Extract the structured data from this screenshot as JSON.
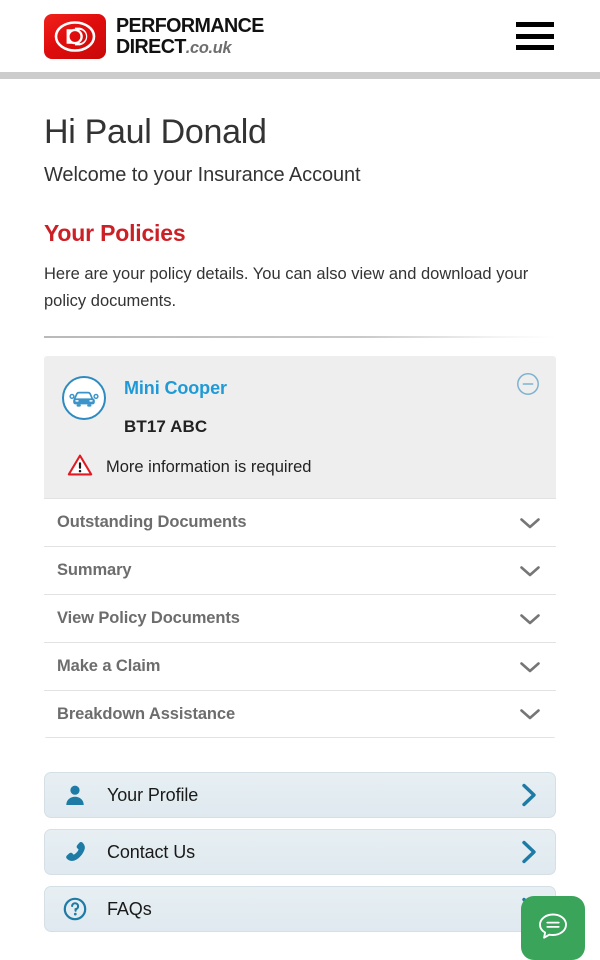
{
  "header": {
    "logo": {
      "icon": "performance-direct-logo-mark",
      "line1": "PERFORMANCE",
      "line2": "DIRECT",
      "suffix": ".co.uk"
    },
    "menu_icon": "hamburger-menu-icon"
  },
  "account": {
    "greeting": "Hi Paul Donald",
    "subtitle": "Welcome to your Insurance Account"
  },
  "policies_section": {
    "title": "Your Policies",
    "description": "Here are your policy details. You can also view and download your policy documents."
  },
  "policy": {
    "vehicle_icon": "car-front-icon",
    "vehicle_name": "Mini Cooper",
    "registration": "BT17 ABC",
    "alert_icon": "warning-triangle-icon",
    "alert_text": "More information is required",
    "collapse_icon": "circle-minus-icon",
    "accent_color": "#1f9ad6",
    "alert_color": "#e01b24",
    "sections": [
      {
        "label": "Outstanding Documents",
        "icon": "chevron-down-icon"
      },
      {
        "label": "Summary",
        "icon": "chevron-down-icon"
      },
      {
        "label": "View Policy Documents",
        "icon": "chevron-down-icon"
      },
      {
        "label": "Make a Claim",
        "icon": "chevron-down-icon"
      },
      {
        "label": "Breakdown Assistance",
        "icon": "chevron-down-icon"
      }
    ]
  },
  "nav": {
    "items": [
      {
        "label": "Your Profile",
        "icon": "person-icon",
        "chevron": "chevron-right-icon"
      },
      {
        "label": "Contact Us",
        "icon": "phone-icon",
        "chevron": "chevron-right-icon"
      },
      {
        "label": "FAQs",
        "icon": "question-circle-icon",
        "chevron": "chevron-right-icon"
      }
    ]
  },
  "chat": {
    "icon": "chat-bubble-icon",
    "color": "#3aa45b"
  },
  "theme": {
    "brand_red": "#cc2027",
    "heading_red": "#cc2027",
    "link_blue": "#1f9ad6",
    "nav_blue": "#1d7ba5"
  }
}
